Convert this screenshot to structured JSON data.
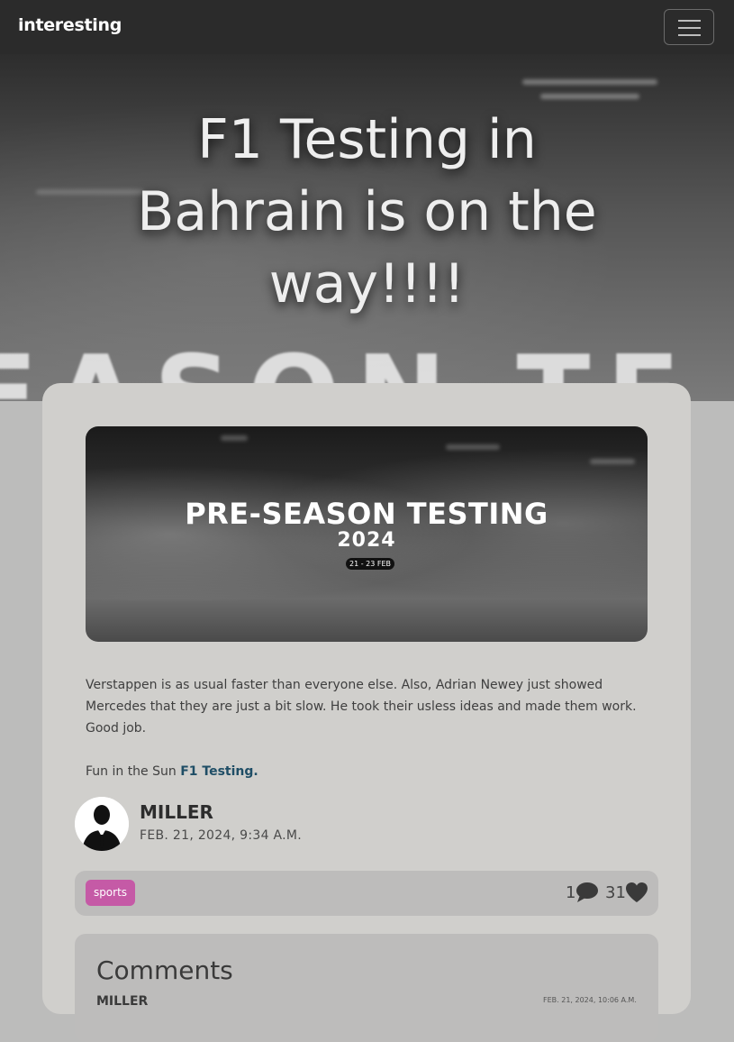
{
  "navbar": {
    "brand": "interesting",
    "toggle_icon": "hamburger-menu-icon"
  },
  "hero": {
    "title": "F1 Testing in Bahrain is on the way!!!!",
    "background_text": "EASON TE"
  },
  "post": {
    "image": {
      "title": "PRE-SEASON TESTING",
      "year": "2024",
      "dates": "21 - 23 FEB"
    },
    "body": "Verstappen is as usual faster than everyone else. Also, Adrian Newey just showed Mercedes that they are just a bit slow. He took their usless ideas and made them work. Good job.",
    "fun_prefix": "Fun in the Sun ",
    "fun_link": "F1 Testing.",
    "author": {
      "name": "MILLER",
      "date": "FEB. 21, 2024, 9:34 A.M.",
      "avatar_icon": "person-silhouette-icon"
    },
    "tag": "sports",
    "comment_count": "1",
    "comment_icon": "comment-bubble-icon",
    "like_count": "31",
    "like_icon": "heart-icon"
  },
  "comments": {
    "heading": "Comments",
    "first": {
      "author": "MILLER",
      "date": "FEB. 21, 2024, 10:06 A.M."
    }
  },
  "colors": {
    "navbar": "#2b2b2b",
    "page_background": "#bcbcbb",
    "card": "#d0cfcc",
    "tag": "#c55aa6",
    "link": "#1f4e66"
  }
}
